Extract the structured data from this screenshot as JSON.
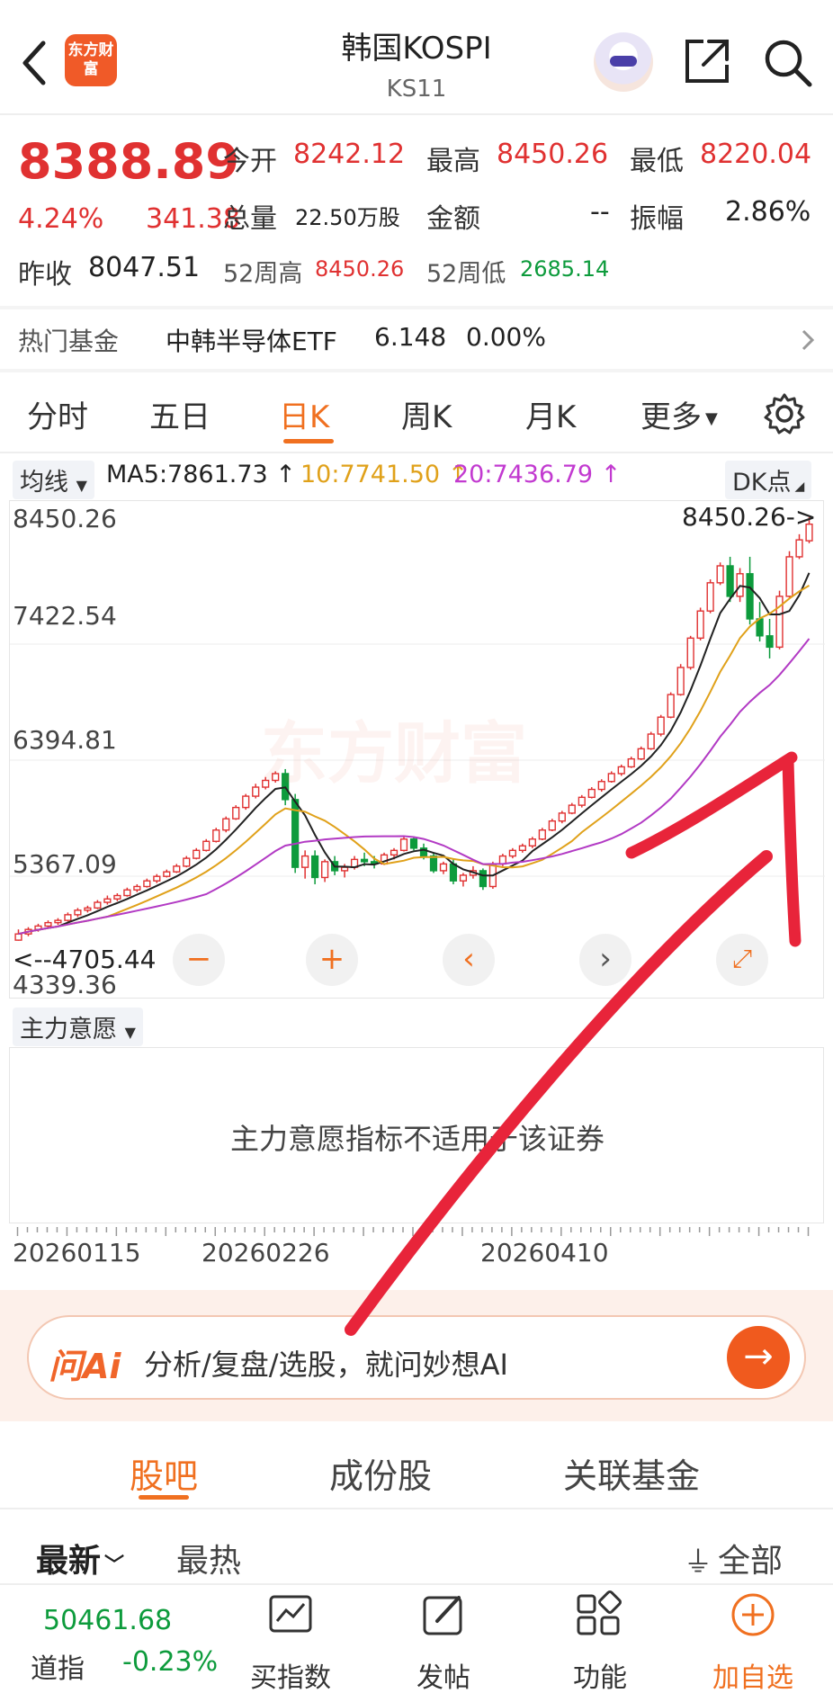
{
  "header": {
    "title": "韩国KOSPI",
    "code": "KS11",
    "logo_text": "东方财富"
  },
  "quote": {
    "price": "8388.89",
    "change_pct": "4.24%",
    "change": "341.38",
    "prev_close_label": "昨收",
    "prev_close": "8047.51",
    "open_label": "今开",
    "open": "8242.12",
    "high_label": "最高",
    "high": "8450.26",
    "low_label": "最低",
    "low": "8220.04",
    "volume_label": "总量",
    "volume": "22.50万股",
    "amount_label": "金额",
    "amount": "--",
    "amplitude_label": "振幅",
    "amplitude": "2.86%",
    "w52_high_label": "52周高",
    "w52_high": "8450.26",
    "w52_low_label": "52周低",
    "w52_low": "2685.14"
  },
  "hot_fund": {
    "label": "热门基金",
    "name": "中韩半导体ETF",
    "price": "6.148",
    "change": "0.00%"
  },
  "k_tabs": [
    {
      "label": "分时"
    },
    {
      "label": "五日"
    },
    {
      "label": "日K"
    },
    {
      "label": "周K"
    },
    {
      "label": "月K"
    },
    {
      "label": "更多"
    }
  ],
  "ma": {
    "selector": "均线",
    "ma5": "MA5:7861.73 ↑",
    "ma10": "10:7741.50 ↑",
    "ma20": "20:7436.79 ↑",
    "dk": "DK点"
  },
  "chart_data": {
    "type": "candlestick",
    "y_ticks": [
      "8450.26",
      "7422.54",
      "6394.81",
      "5367.09",
      "4339.36"
    ],
    "ylim": [
      4339.36,
      8450.26
    ],
    "x_ticks": [
      "20260115",
      "20260226",
      "20260410"
    ],
    "max_label": "8450.26->",
    "min_label": "<--4705.44",
    "watermark": "东方财富",
    "up_color": "#e03131",
    "down_color": "#0d9b3c",
    "candles": [
      [
        4705,
        4800,
        4700,
        4760
      ],
      [
        4760,
        4820,
        4740,
        4800
      ],
      [
        4800,
        4850,
        4780,
        4830
      ],
      [
        4830,
        4880,
        4810,
        4860
      ],
      [
        4860,
        4900,
        4840,
        4880
      ],
      [
        4880,
        4950,
        4870,
        4930
      ],
      [
        4930,
        4990,
        4910,
        4970
      ],
      [
        4970,
        5010,
        4950,
        4990
      ],
      [
        4990,
        5060,
        4980,
        5040
      ],
      [
        5040,
        5100,
        5020,
        5070
      ],
      [
        5070,
        5120,
        5050,
        5100
      ],
      [
        5100,
        5170,
        5090,
        5150
      ],
      [
        5150,
        5200,
        5130,
        5180
      ],
      [
        5180,
        5250,
        5170,
        5230
      ],
      [
        5230,
        5290,
        5210,
        5270
      ],
      [
        5270,
        5330,
        5260,
        5310
      ],
      [
        5310,
        5380,
        5300,
        5360
      ],
      [
        5360,
        5450,
        5350,
        5430
      ],
      [
        5430,
        5520,
        5420,
        5500
      ],
      [
        5500,
        5600,
        5490,
        5580
      ],
      [
        5580,
        5700,
        5570,
        5680
      ],
      [
        5680,
        5800,
        5660,
        5780
      ],
      [
        5780,
        5900,
        5770,
        5880
      ],
      [
        5880,
        6000,
        5860,
        5980
      ],
      [
        5980,
        6090,
        5960,
        6060
      ],
      [
        6060,
        6150,
        6040,
        6120
      ],
      [
        6120,
        6200,
        6100,
        6180
      ],
      [
        6180,
        6220,
        5900,
        5950
      ],
      [
        5950,
        6000,
        5300,
        5350
      ],
      [
        5350,
        5500,
        5250,
        5450
      ],
      [
        5450,
        5500,
        5200,
        5260
      ],
      [
        5260,
        5420,
        5220,
        5400
      ],
      [
        5400,
        5450,
        5280,
        5320
      ],
      [
        5320,
        5380,
        5260,
        5350
      ],
      [
        5350,
        5450,
        5330,
        5420
      ],
      [
        5420,
        5480,
        5360,
        5400
      ],
      [
        5400,
        5450,
        5340,
        5380
      ],
      [
        5380,
        5480,
        5370,
        5460
      ],
      [
        5460,
        5520,
        5420,
        5500
      ],
      [
        5500,
        5620,
        5490,
        5600
      ],
      [
        5600,
        5620,
        5500,
        5520
      ],
      [
        5520,
        5560,
        5420,
        5450
      ],
      [
        5450,
        5480,
        5300,
        5320
      ],
      [
        5320,
        5400,
        5290,
        5380
      ],
      [
        5380,
        5420,
        5200,
        5230
      ],
      [
        5230,
        5300,
        5180,
        5280
      ],
      [
        5280,
        5360,
        5250,
        5320
      ],
      [
        5320,
        5340,
        5150,
        5180
      ],
      [
        5180,
        5400,
        5160,
        5380
      ],
      [
        5380,
        5470,
        5360,
        5450
      ],
      [
        5450,
        5520,
        5430,
        5500
      ],
      [
        5500,
        5560,
        5480,
        5540
      ],
      [
        5540,
        5620,
        5520,
        5600
      ],
      [
        5600,
        5700,
        5590,
        5680
      ],
      [
        5680,
        5780,
        5670,
        5760
      ],
      [
        5760,
        5850,
        5740,
        5830
      ],
      [
        5830,
        5920,
        5820,
        5900
      ],
      [
        5900,
        5990,
        5880,
        5970
      ],
      [
        5970,
        6060,
        5960,
        6040
      ],
      [
        6040,
        6130,
        6020,
        6110
      ],
      [
        6110,
        6200,
        6100,
        6180
      ],
      [
        6180,
        6260,
        6160,
        6240
      ],
      [
        6240,
        6330,
        6230,
        6310
      ],
      [
        6310,
        6420,
        6300,
        6400
      ],
      [
        6400,
        6550,
        6390,
        6530
      ],
      [
        6530,
        6700,
        6510,
        6680
      ],
      [
        6680,
        6900,
        6670,
        6880
      ],
      [
        6880,
        7150,
        6870,
        7120
      ],
      [
        7120,
        7400,
        7100,
        7380
      ],
      [
        7380,
        7650,
        7360,
        7620
      ],
      [
        7620,
        7900,
        7600,
        7870
      ],
      [
        7870,
        8050,
        7850,
        8020
      ],
      [
        8020,
        8100,
        7700,
        7750
      ],
      [
        7750,
        8000,
        7700,
        7950
      ],
      [
        7950,
        8100,
        7500,
        7550
      ],
      [
        7550,
        7700,
        7350,
        7400
      ],
      [
        7400,
        7550,
        7200,
        7300
      ],
      [
        7300,
        7800,
        7280,
        7750
      ],
      [
        7750,
        8150,
        7740,
        8100
      ],
      [
        8100,
        8300,
        8080,
        8250
      ],
      [
        8242,
        8450,
        8220,
        8389
      ]
    ]
  },
  "indicator": {
    "selector": "主力意愿",
    "message": "主力意愿指标不适用于该证券"
  },
  "ai_bar": {
    "logo": "问Ai",
    "placeholder": "分析/复盘/选股，就问妙想AI",
    "go": "→"
  },
  "section_tabs": [
    {
      "label": "股吧"
    },
    {
      "label": "成份股"
    },
    {
      "label": "关联基金"
    }
  ],
  "sort": {
    "latest": "最新",
    "hot": "最热",
    "filter": "全部"
  },
  "bottom_bar": {
    "ticker_value": "50461.68",
    "ticker_name": "道指",
    "ticker_change": "-0.23%",
    "items": [
      {
        "label": "买指数"
      },
      {
        "label": "发帖"
      },
      {
        "label": "功能"
      },
      {
        "label": "加自选"
      }
    ]
  }
}
